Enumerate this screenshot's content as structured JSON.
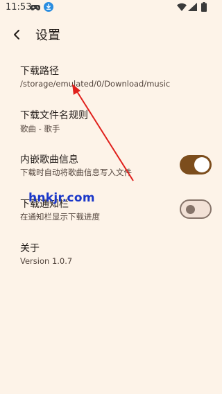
{
  "status_bar": {
    "time": "11:53"
  },
  "header": {
    "title": "设置"
  },
  "settings": [
    {
      "title": "下载路径",
      "subtitle": "/storage/emulated/0/Download/music"
    },
    {
      "title": "下载文件名规则",
      "subtitle": "歌曲 - 歌手"
    },
    {
      "title": "内嵌歌曲信息",
      "subtitle": "下载时自动将歌曲信息写入文件",
      "switch_on": true
    },
    {
      "title": "下载通知栏",
      "subtitle": "在通知栏显示下载进度",
      "switch_on": false
    },
    {
      "title": "关于",
      "subtitle": "Version 1.0.7"
    }
  ],
  "watermark": "hnkjr.com",
  "colors": {
    "background": "#fdf3e8",
    "accent": "#7c4d1c",
    "annotation_arrow": "#e0201c",
    "watermark": "#1a37c9"
  }
}
